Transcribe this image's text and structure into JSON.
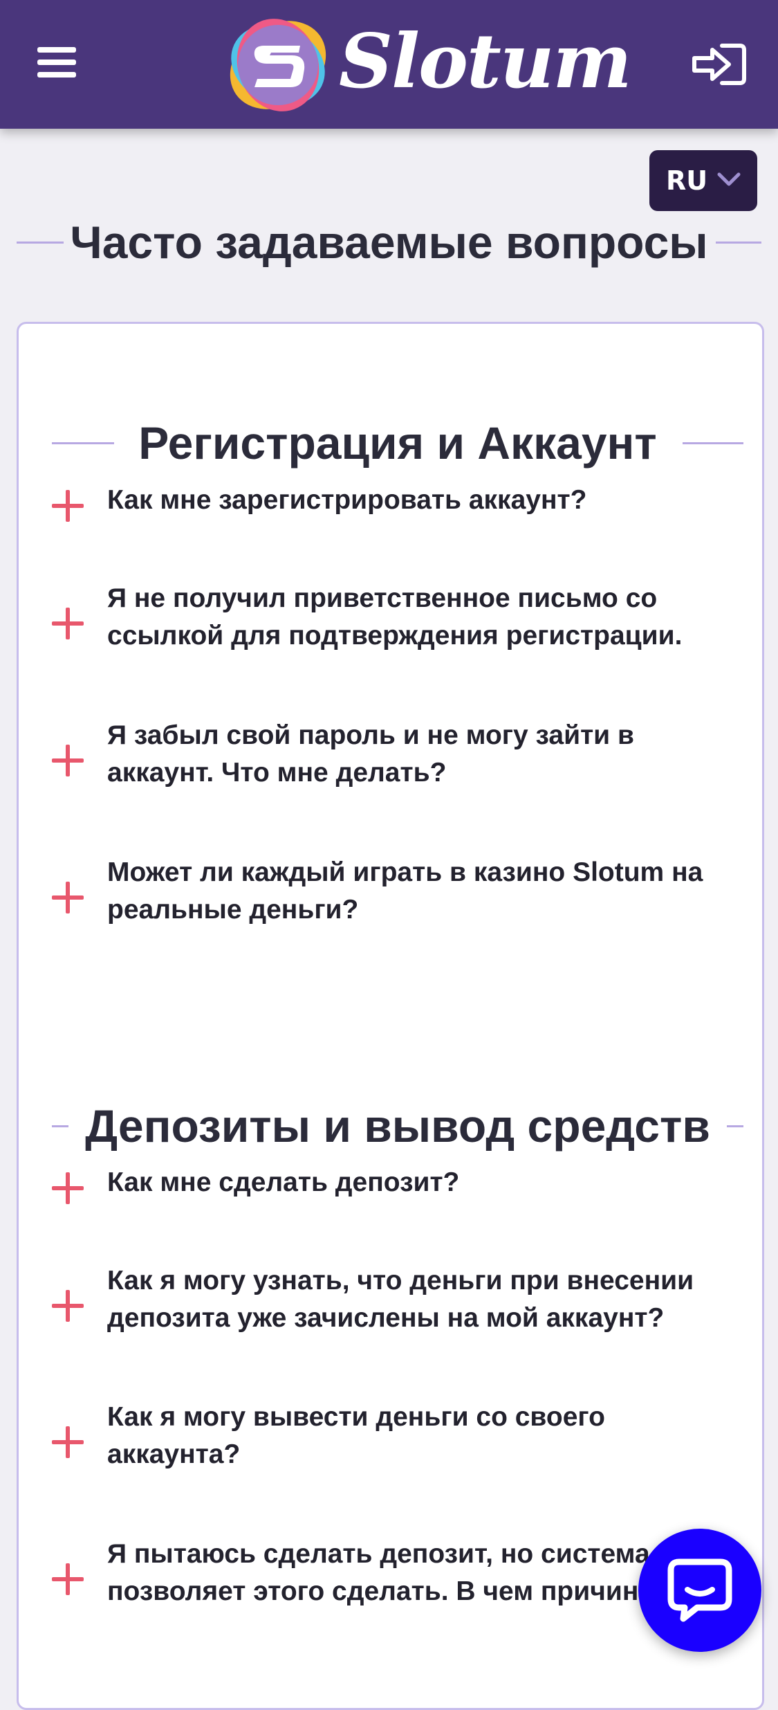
{
  "header": {
    "brand": "Slotum",
    "menu_icon": "hamburger-icon",
    "login_icon": "login-icon"
  },
  "language": {
    "selected": "RU",
    "icon": "chevron-down-icon"
  },
  "page_title": "Часто задаваемые вопросы",
  "sections": [
    {
      "title": "Регистрация и Аккаунт",
      "questions": [
        "Как мне зарегистрировать аккаунт?",
        "Я не получил приветственное письмо со ссылкой для подтверждения регистрации.",
        "Я забыл свой пароль и не могу зайти в аккаунт. Что мне делать?",
        "Может ли каждый играть в казино Slotum на реальные деньги?"
      ]
    },
    {
      "title": "Депозиты и вывод средств",
      "questions": [
        "Как мне сделать депозит?",
        "Как я могу узнать, что деньги при внесении депозита уже зачислены на мой аккаунт?",
        "Как я могу вывести деньги со своего аккаунта?",
        "Я пытаюсь сделать депозит, но система не позволяет этого сделать. В чем причина?"
      ]
    }
  ],
  "chat": {
    "icon": "chat-icon"
  },
  "colors": {
    "header_bg": "#4a367c",
    "accent_plus": "#e8576c",
    "chat_bg": "#1a00ff",
    "card_border": "#c7bdec"
  }
}
